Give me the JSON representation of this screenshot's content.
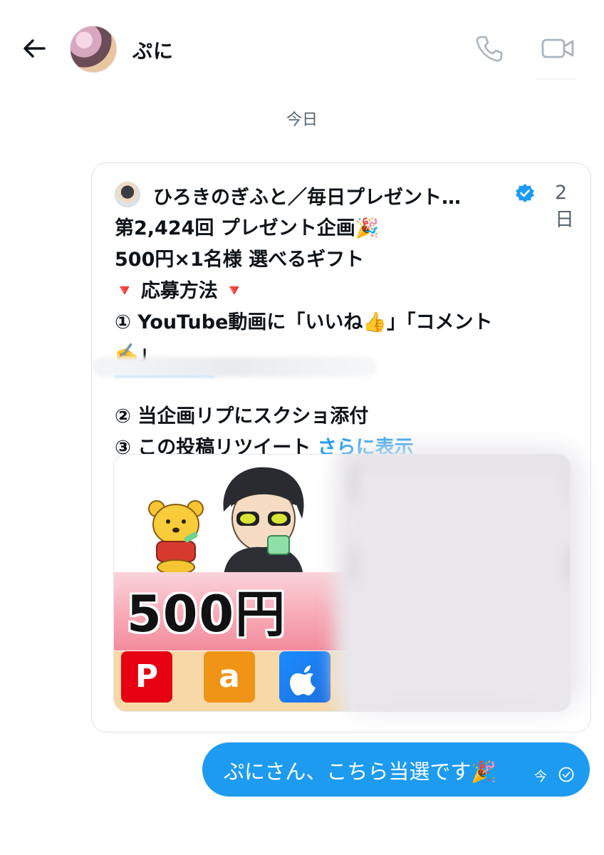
{
  "header": {
    "contact_name": "ぷに",
    "icons": [
      "back-arrow-icon",
      "phone-icon",
      "video-icon"
    ]
  },
  "conversation": {
    "date_separator": "今日"
  },
  "shared_post": {
    "author_name": "ひろきのぎふと／毎日プレゼント…",
    "age": "2日",
    "lines": [
      "第2,424回 プレゼント企画",
      "500円×1名様 選べるギフト",
      "応募方法",
      "① YouTube動画に「いいね",
      "」「コメント",
      "」",
      "② 当企画リプにスクショ添付",
      "③ この投稿リツイート"
    ],
    "show_more": "さらに表示",
    "emojis": {
      "party": "🎉",
      "triangle": "🔻",
      "thumbs_up": "👍",
      "writing": "✍️"
    },
    "media": {
      "price_text": "500円",
      "logos": [
        "paypay-logo",
        "amazon-logo",
        "apple-logo"
      ],
      "amazon_glyph": "a",
      "paypay_glyph": "P",
      "apple_glyph": ""
    }
  },
  "sent_message": {
    "text": "ぷにさん、こちら当選です",
    "emoji": "🎉",
    "time": "今"
  },
  "colors": {
    "accent": "#1d9bf0",
    "secondary_text": "#536471",
    "border": "#dfe4e8"
  }
}
